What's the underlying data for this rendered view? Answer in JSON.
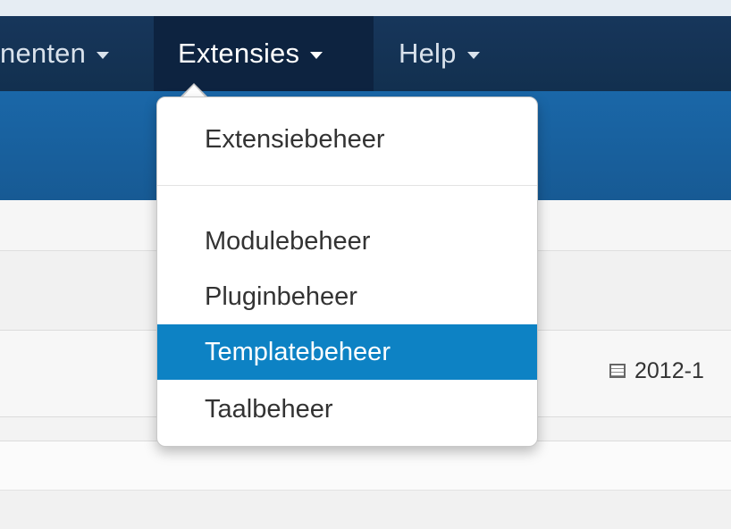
{
  "navbar": {
    "items": [
      {
        "label": "nenten"
      },
      {
        "label": "Extensies"
      },
      {
        "label": "Help"
      }
    ]
  },
  "date_text": "2012-1",
  "dropdown": {
    "items": [
      {
        "label": "Extensiebeheer"
      },
      {
        "label": "Modulebeheer"
      },
      {
        "label": "Pluginbeheer"
      },
      {
        "label": "Templatebeheer",
        "highlighted": true
      },
      {
        "label": "Taalbeheer"
      }
    ]
  },
  "icons": [
    "caret-down-icon",
    "calendar-icon"
  ],
  "colors": {
    "navbar": "#12304f",
    "subheader": "#1a67a8",
    "highlight": "#0d82c4"
  }
}
